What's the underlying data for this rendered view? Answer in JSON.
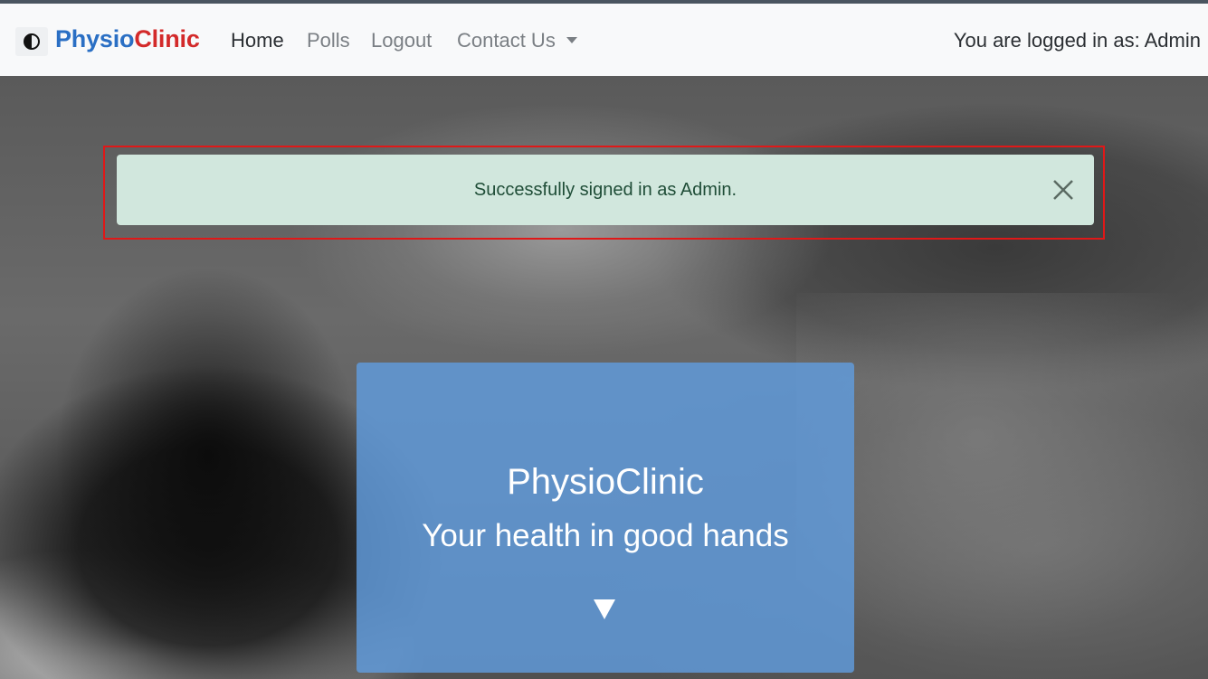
{
  "navbar": {
    "theme_toggle_icon": "half-circle-contrast-icon",
    "brand_part1": "Physio",
    "brand_part2": "Clinic",
    "brand_colors": {
      "part1": "#2a6fc4",
      "part2": "#d32a2a"
    },
    "links": [
      {
        "label": "Home",
        "active": true
      },
      {
        "label": "Polls",
        "active": false
      },
      {
        "label": "Logout",
        "active": false
      },
      {
        "label": "Contact Us",
        "active": false,
        "dropdown": true
      }
    ],
    "logged_in_text": "You are logged in as: Admin"
  },
  "alert": {
    "message": "Successfully signed in as Admin.",
    "close_icon": "close-icon",
    "background": "#d1e7dd",
    "highlight_color": "#e01818"
  },
  "hero": {
    "title": "PhysioClinic",
    "subtitle": "Your health in good hands",
    "arrow_icon": "triangle-down-icon",
    "card_color": "#609cde"
  }
}
